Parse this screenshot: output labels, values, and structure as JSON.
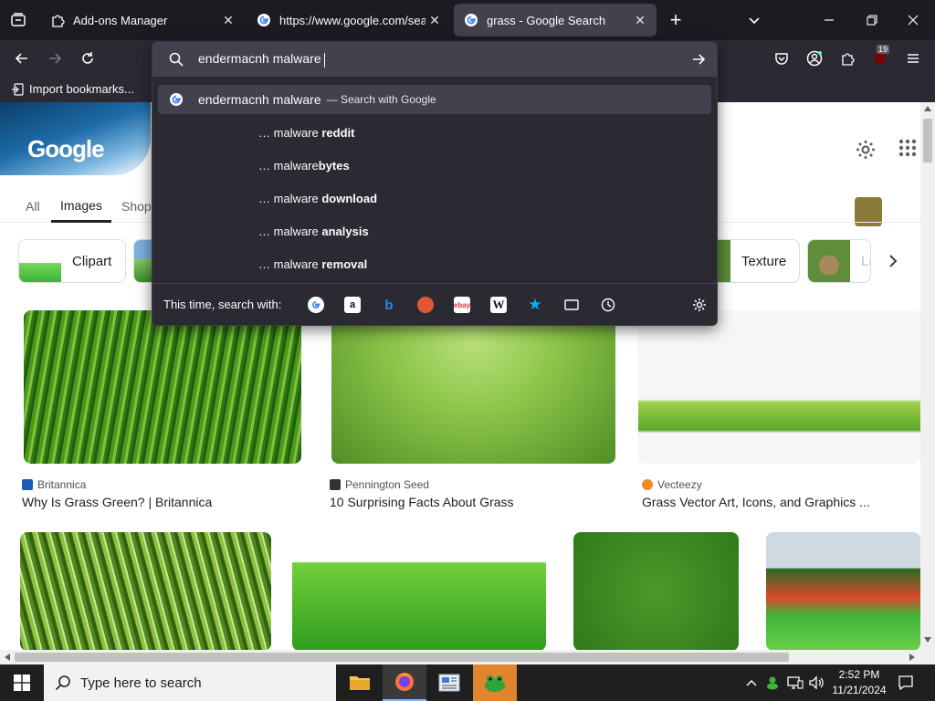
{
  "tabs": [
    {
      "title": "Add-ons Manager"
    },
    {
      "title": "https://www.google.com/searc"
    },
    {
      "title": "grass - Google Search"
    }
  ],
  "bookmarks": {
    "import_label": "Import bookmarks..."
  },
  "extensions": {
    "badge_count": "19"
  },
  "urlbar": {
    "value": "endermacnh malware",
    "suggestions": [
      {
        "prefix": "endermacnh malware",
        "suffix": "— Search with Google",
        "bold": ""
      },
      {
        "prefix": "… malware ",
        "bold": "reddit"
      },
      {
        "prefix": "… malware",
        "bold": "bytes"
      },
      {
        "prefix": "… malware ",
        "bold": "download"
      },
      {
        "prefix": "… malware ",
        "bold": "analysis"
      },
      {
        "prefix": "… malware ",
        "bold": "removal"
      }
    ],
    "one_off_label": "This time, search with:"
  },
  "google": {
    "logo_text": "Google",
    "tabs": [
      {
        "label": "All"
      },
      {
        "label": "Images"
      },
      {
        "label": "Shop"
      }
    ],
    "chips": [
      {
        "label": "Clipart"
      },
      {
        "label": "Texture"
      },
      {
        "label": "La"
      }
    ],
    "results": [
      {
        "source": "Britannica",
        "title": "Why Is Grass Green? | Britannica"
      },
      {
        "source": "Pennington Seed",
        "title": "10 Surprising Facts About Grass"
      },
      {
        "source": "Vecteezy",
        "title": "Grass Vector Art, Icons, and Graphics ..."
      }
    ]
  },
  "taskbar": {
    "search_placeholder": "Type here to search",
    "time": "2:52 PM",
    "date": "11/21/2024"
  }
}
